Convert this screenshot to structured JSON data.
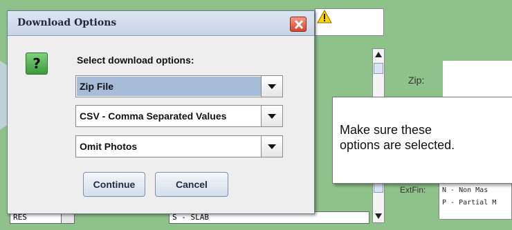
{
  "dialog": {
    "title": "Download Options",
    "prompt": "Select download options:",
    "help_icon_glyph": "?",
    "format_select": {
      "value": "Zip File"
    },
    "type_select": {
      "value": "CSV - Comma Separated Values"
    },
    "photos_select": {
      "value": "Omit Photos"
    },
    "continue_label": "Continue",
    "cancel_label": "Cancel"
  },
  "callout": {
    "line1": "Make sure these",
    "line2": "options are selected."
  },
  "background": {
    "zip_label": "Zip:",
    "extfin_label": "ExtFin:",
    "extfin_options": [
      "N - Non Mas",
      "P - Partial M"
    ],
    "res_value": "RES",
    "slab_value": "S - SLAB"
  },
  "colors": {
    "app_background": "#8fc28a",
    "selection_highlight": "#a6bcd9",
    "close_button": "#d7452c",
    "help_icon": "#3b9b3b"
  }
}
